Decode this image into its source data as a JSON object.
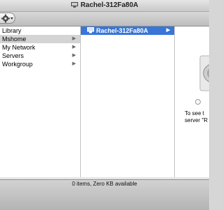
{
  "window": {
    "title": "Rachel-312Fa80A"
  },
  "toolbar": {
    "action_icon": "gear-icon"
  },
  "sidebar": {
    "items": [
      {
        "label": "Library",
        "has_children": false,
        "selected": false
      },
      {
        "label": "Mshome",
        "has_children": true,
        "selected": true
      },
      {
        "label": "My Network",
        "has_children": true,
        "selected": false
      },
      {
        "label": "Servers",
        "has_children": true,
        "selected": false
      },
      {
        "label": "Workgroup",
        "has_children": true,
        "selected": false
      }
    ],
    "arrow_glyph": "▶"
  },
  "column2": {
    "items": [
      {
        "label": "Rachel-312Fa80A",
        "icon": "network-computer-icon",
        "selected": true
      }
    ],
    "arrow_glyph": "▶"
  },
  "preview": {
    "icon": "server-icon",
    "line1": "To see t",
    "line2": "server \"R"
  },
  "status": {
    "text": "0 items, Zero KB available"
  },
  "colors": {
    "selection_blue": "#3876d8",
    "selection_grey": "#d4d4d4"
  }
}
